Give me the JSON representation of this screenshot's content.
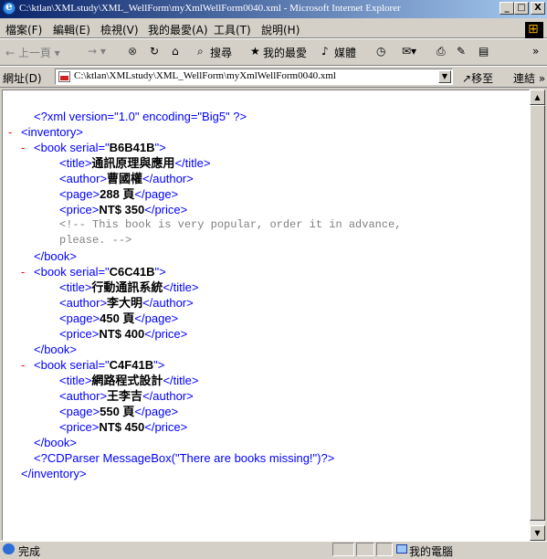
{
  "window": {
    "title": "C:\\ktlan\\XMLstudy\\XML_WellForm\\myXmlWellForm0040.xml - Microsoft Internet Explorer",
    "controls": {
      "minimize": "_",
      "maximize": "□",
      "close": "X"
    }
  },
  "menu": [
    "檔案(F)",
    "編輯(E)",
    "檢視(V)",
    "我的最愛(A)",
    "工具(T)",
    "說明(H)"
  ],
  "toolbar": {
    "back": "← 上一頁 ▾",
    "forward": "→ ▾",
    "stop": "⊗",
    "refresh": "↻",
    "home": "⌂",
    "search": "搜尋",
    "favorites": "我的最愛",
    "media": "媒體",
    "more": "»"
  },
  "address": {
    "label": "網址(D)",
    "value": "C:\\ktlan\\XMLstudy\\XML_WellForm\\myXmlWellForm0040.xml",
    "go": "移至",
    "links": "連結 »"
  },
  "xml": {
    "declaration": "<?xml version=\"1.0\" encoding=\"Big5\" ?>",
    "root_open": "<inventory>",
    "root_close": "</inventory>",
    "books": [
      {
        "serial": "B6B41B",
        "title": "通訊原理與應用",
        "author": "曹國權",
        "page": "288 頁",
        "price": "NT$ 350",
        "comment_1": "<!-- This book is very popular, order it in advance,",
        "comment_2": "please. -->"
      },
      {
        "serial": "C6C41B",
        "title": "行動通訊系統",
        "author": "李大明",
        "page": "450 頁",
        "price": "NT$ 400"
      },
      {
        "serial": "C4F41B",
        "title": "網路程式設計",
        "author": "王李吉",
        "page": "550 頁",
        "price": "NT$ 450"
      }
    ],
    "pi": "<?CDParser MessageBox(\"There are books missing!\")?>"
  },
  "status": {
    "text": "完成",
    "zone": "我的電腦"
  }
}
